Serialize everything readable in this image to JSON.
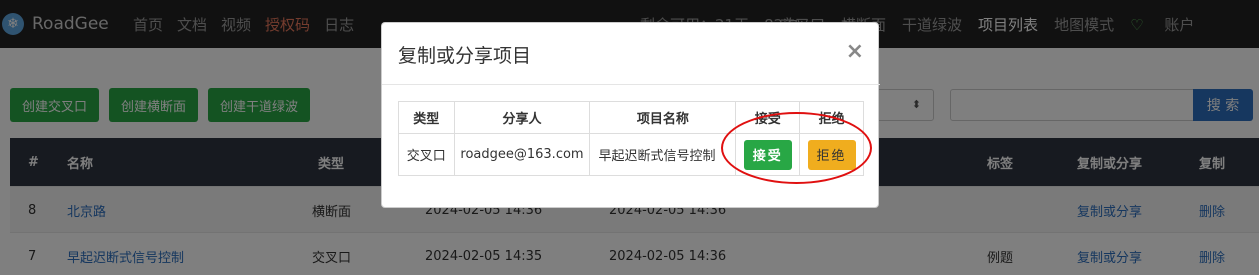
{
  "navbar": {
    "brand": "RoadGee",
    "left_items": [
      {
        "label": "首页",
        "active": false
      },
      {
        "label": "文档",
        "active": false
      },
      {
        "label": "视频",
        "active": false
      },
      {
        "label": "授权码",
        "active": true
      },
      {
        "label": "日志",
        "active": false
      }
    ],
    "remaining": "剩余可用：21天，82次",
    "right_items": [
      {
        "label": "交叉口",
        "strong": false
      },
      {
        "label": "横断面",
        "strong": false
      },
      {
        "label": "干道绿波",
        "strong": false
      },
      {
        "label": "项目列表",
        "strong": true
      },
      {
        "label": "地图模式",
        "strong": false
      }
    ],
    "account": "账户"
  },
  "toolbar": {
    "create_intersection": "创建交叉口",
    "create_section": "创建横断面",
    "create_green_wave": "创建干道绿波",
    "search_label": "搜 索"
  },
  "table": {
    "headers": [
      "#",
      "名称",
      "类型",
      "",
      "",
      "标签",
      "复制或分享",
      "复制"
    ],
    "rows": [
      {
        "id": "8",
        "name": "北京路",
        "type": "横断面",
        "created": "2024-02-05 14:36",
        "modified": "2024-02-05 14:36",
        "tag": "",
        "copy": "复制或分享",
        "delete": "删除"
      },
      {
        "id": "7",
        "name": "早起迟断式信号控制",
        "type": "交叉口",
        "created": "2024-02-05 14:35",
        "modified": "2024-02-05 14:36",
        "tag": "例题",
        "copy": "复制或分享",
        "delete": "删除"
      }
    ]
  },
  "modal": {
    "title": "复制或分享项目",
    "close": "×",
    "headers": [
      "类型",
      "分享人",
      "项目名称",
      "接受",
      "拒绝"
    ],
    "row": {
      "type": "交叉口",
      "sharer": "roadgee@163.com",
      "project": "早起迟断式信号控制",
      "accept": "接受",
      "reject": "拒绝"
    }
  },
  "colors": {
    "navbar": "#222222",
    "accept": "#28a745",
    "reject": "#f0ad1e",
    "annotation": "#e01010",
    "link": "#2c6fbe"
  }
}
